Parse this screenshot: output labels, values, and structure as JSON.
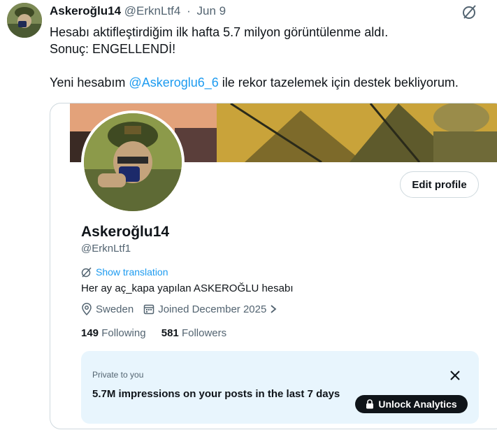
{
  "tweet": {
    "author_name": "Askeroğlu14",
    "author_handle": "@ErknLtf4",
    "separator": "·",
    "date": "Jun 9",
    "line1": "Hesabı aktifleştirdiğim ilk hafta 5.7 milyon görüntülenme aldı.",
    "line2": "Sonuç: ENGELLENDİ!",
    "line3_before": "Yeni hesabım ",
    "line3_mention": "@Askeroglu6_6",
    "line3_after": " ile rekor tazelemek için destek bekliyorum.",
    "grok_icon": "grok-slash-icon"
  },
  "profile_card": {
    "edit_profile_label": "Edit profile",
    "name": "Askeroğlu14",
    "handle": "@ErknLtf1",
    "show_translation": "Show translation",
    "bio": "Her ay aç_kapa yapılan ASKEROĞLU hesabı",
    "location": "Sweden",
    "joined": "Joined December 2025",
    "following_count": "149",
    "following_label": "Following",
    "followers_count": "581",
    "followers_label": "Followers"
  },
  "analytics": {
    "private_label": "Private to you",
    "impressions_text": "5.7M impressions on your posts in the last 7 days",
    "unlock_label": "Unlock Analytics"
  },
  "colors": {
    "accent": "#1d9bf0",
    "text": "#0f1419",
    "muted": "#536471",
    "analytics_bg": "#e8f5fd"
  }
}
